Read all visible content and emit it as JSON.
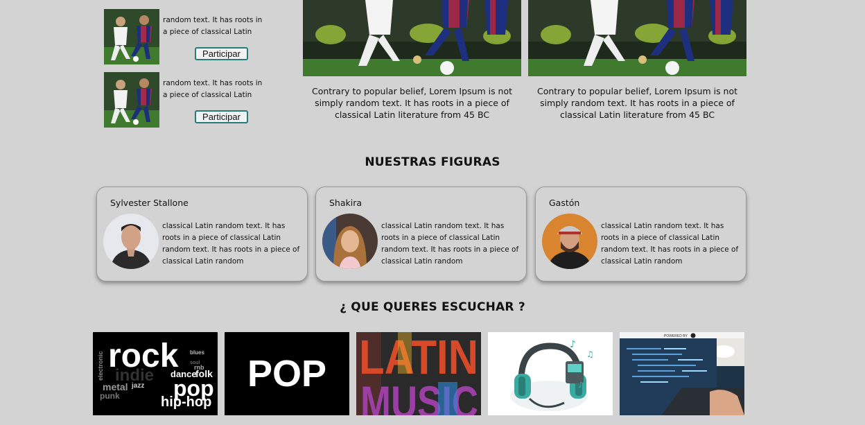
{
  "events": [
    {
      "text": "random text. It has roots in a piece of classical Latin",
      "button": "Participar"
    },
    {
      "text": "random text. It has roots in a piece of classical Latin",
      "button": "Participar"
    }
  ],
  "news": [
    {
      "caption": "Contrary to popular belief, Lorem Ipsum is not simply random text. It has roots in a piece of classical Latin literature from 45 BC"
    },
    {
      "caption": "Contrary to popular belief, Lorem Ipsum is not simply random text. It has roots in a piece of classical Latin literature from 45 BC"
    }
  ],
  "figures_section": {
    "title": "NUESTRAS FIGURAS"
  },
  "figures": [
    {
      "name": "Sylvester Stallone",
      "text": "classical Latin random text. It has roots in a piece of classical Latin random text. It has roots in a piece of classical Latin random"
    },
    {
      "name": "Shakira",
      "text": "classical Latin random text. It has roots in a piece of classical Latin random text. It has roots in a piece of classical Latin random"
    },
    {
      "name": "Gastón",
      "text": "classical Latin random text. It has roots in a piece of classical Latin random text. It has roots in a piece of classical Latin random"
    }
  ],
  "music_section": {
    "title": "¿ QUE QUERES ESCUCHAR ?"
  },
  "genres": {
    "rock": {
      "big": "rock",
      "pop": "pop",
      "hiphop": "hip-hop",
      "indie": "indie",
      "metal": "metal",
      "jazz": "jazz",
      "punk": "punk",
      "dance": "dance",
      "folk": "folk",
      "electronic": "electronic",
      "blues": "blues",
      "soul": "soul",
      "rnb": "rnb"
    },
    "pop": {
      "label": "POP"
    },
    "latin": {
      "line1": "LATIN",
      "line2": "MUSIC"
    },
    "coding": {
      "banner": "POWERED BY"
    }
  }
}
